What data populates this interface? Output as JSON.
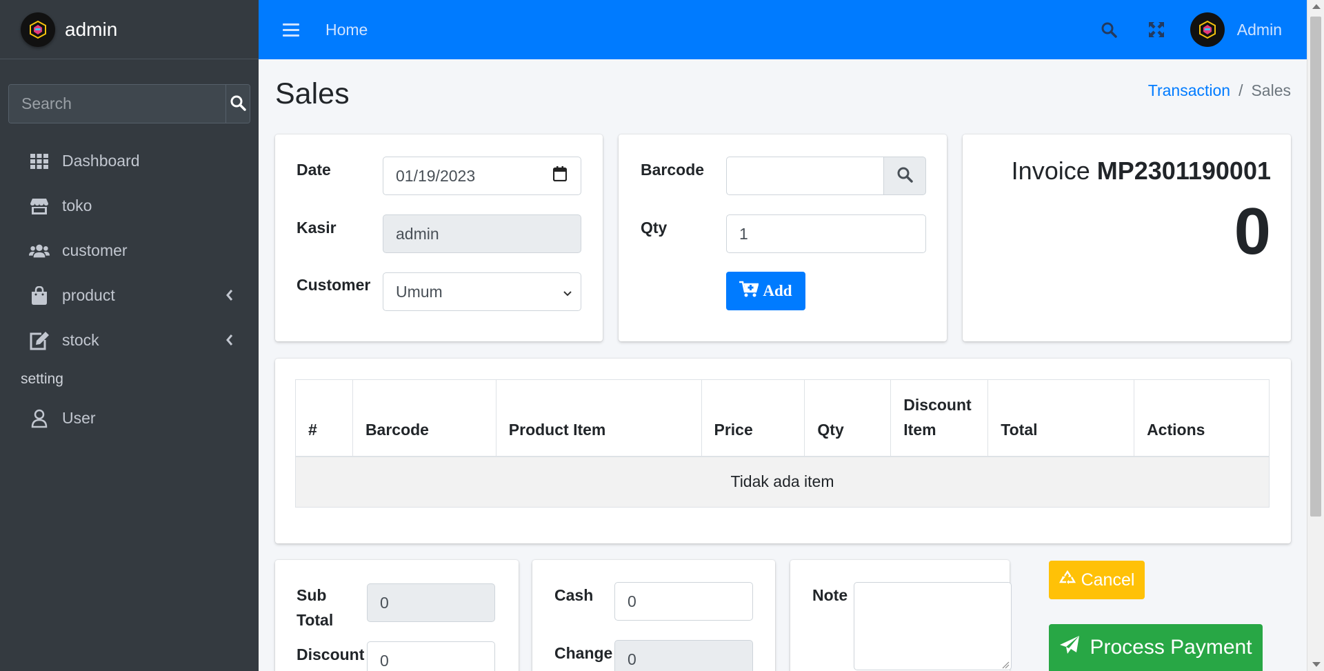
{
  "sidebar": {
    "brand": "admin",
    "search_placeholder": "Search",
    "items": [
      {
        "label": "Dashboard",
        "icon": "grid-icon"
      },
      {
        "label": "toko",
        "icon": "store-icon"
      },
      {
        "label": "customer",
        "icon": "users-icon"
      },
      {
        "label": "product",
        "icon": "shopping-bag-icon"
      },
      {
        "label": "stock",
        "icon": "edit-icon"
      }
    ],
    "header": "setting",
    "setting_items": [
      {
        "label": "User",
        "icon": "user-icon"
      }
    ]
  },
  "topbar": {
    "home": "Home",
    "user": "Admin",
    "color": "#007bff"
  },
  "page": {
    "title": "Sales",
    "breadcrumb": {
      "parent": "Transaction",
      "separator": "/",
      "current": "Sales"
    }
  },
  "form_left": {
    "date_label": "Date",
    "date_value": "01/19/2023",
    "kasir_label": "Kasir",
    "kasir_value": "admin",
    "customer_label": "Customer",
    "customer_value": "Umum"
  },
  "form_mid": {
    "barcode_label": "Barcode",
    "barcode_value": "",
    "qty_label": "Qty",
    "qty_value": "1",
    "add_label": "Add"
  },
  "invoice": {
    "prefix": "Invoice",
    "number": "MP2301190001",
    "total": "0"
  },
  "table": {
    "headers": [
      "#",
      "Barcode",
      "Product Item",
      "Price",
      "Qty",
      "Discount Item",
      "Total",
      "Actions"
    ],
    "empty": "Tidak ada item"
  },
  "summary": {
    "subtotal_label": "Sub Total",
    "subtotal_value": "0",
    "discount_label": "Discount",
    "discount_value": "0",
    "cash_label": "Cash",
    "cash_value": "0",
    "change_label": "Change",
    "change_value": "0",
    "note_label": "Note",
    "note_value": ""
  },
  "actions": {
    "cancel": "Cancel",
    "process": "Process Payment",
    "cancel_color": "#ffc107",
    "process_color": "#28a745"
  }
}
